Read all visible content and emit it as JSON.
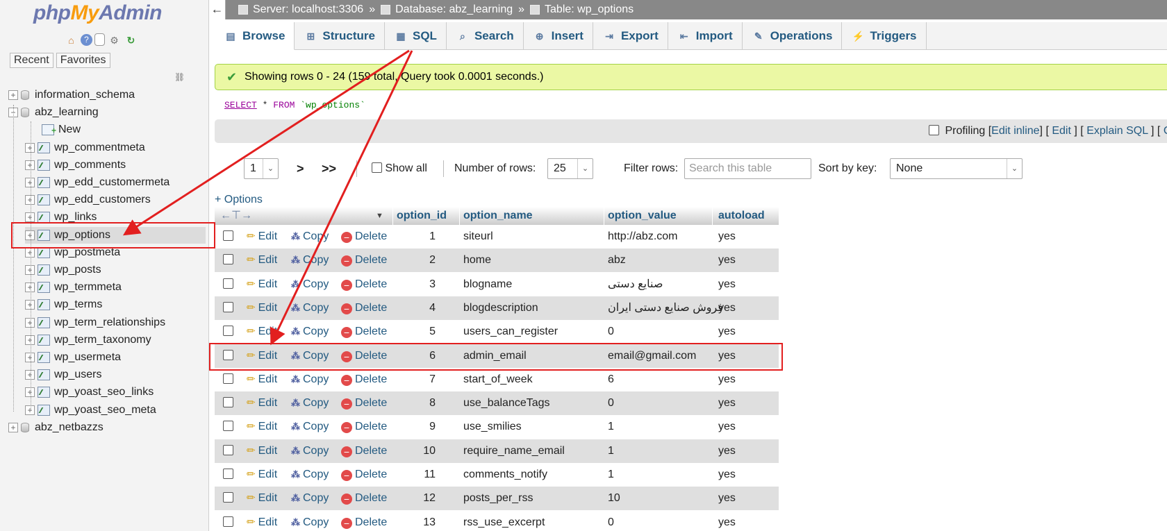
{
  "sidebar": {
    "logo_php": "php",
    "logo_my": "My",
    "logo_admin": "Admin",
    "tabs": [
      "Recent",
      "Favorites"
    ],
    "icons": [
      "home-icon",
      "info-icon",
      "docs-icon",
      "settings-icon",
      "reload-icon"
    ],
    "tree": [
      {
        "label": "information_schema",
        "type": "db",
        "expanded": false
      },
      {
        "label": "abz_learning",
        "type": "db",
        "expanded": true
      },
      {
        "label": "New",
        "type": "new"
      },
      {
        "label": "wp_commentmeta",
        "type": "table"
      },
      {
        "label": "wp_comments",
        "type": "table"
      },
      {
        "label": "wp_edd_customermeta",
        "type": "table"
      },
      {
        "label": "wp_edd_customers",
        "type": "table"
      },
      {
        "label": "wp_links",
        "type": "table"
      },
      {
        "label": "wp_options",
        "type": "table",
        "selected": true
      },
      {
        "label": "wp_postmeta",
        "type": "table"
      },
      {
        "label": "wp_posts",
        "type": "table"
      },
      {
        "label": "wp_termmeta",
        "type": "table"
      },
      {
        "label": "wp_terms",
        "type": "table"
      },
      {
        "label": "wp_term_relationships",
        "type": "table"
      },
      {
        "label": "wp_term_taxonomy",
        "type": "table"
      },
      {
        "label": "wp_usermeta",
        "type": "table"
      },
      {
        "label": "wp_users",
        "type": "table"
      },
      {
        "label": "wp_yoast_seo_links",
        "type": "table"
      },
      {
        "label": "wp_yoast_seo_meta",
        "type": "table"
      },
      {
        "label": "abz_netbazzs",
        "type": "db",
        "expanded": false
      }
    ]
  },
  "breadcrumb": {
    "back": "←",
    "server": "Server: localhost:3306",
    "database": "Database: abz_learning",
    "table": "Table: wp_options",
    "sep": "»"
  },
  "tabs": [
    "Browse",
    "Structure",
    "SQL",
    "Search",
    "Insert",
    "Export",
    "Import",
    "Operations",
    "Triggers"
  ],
  "message": "Showing rows 0 - 24 (159 total, Query took 0.0001 seconds.)",
  "sql": {
    "kw1": "SELECT",
    "mid": " * ",
    "kw2": "FROM",
    "table": "`wp_options`"
  },
  "sql_links": {
    "profiling": "Profiling",
    "edit_inline": "Edit inline",
    "edit": "Edit",
    "explain": "Explain SQL",
    "lb": "[",
    "rb": "]",
    "trail": "C"
  },
  "nav": {
    "page": "1",
    "next": ">",
    "last": ">>",
    "show_all": "Show all",
    "rows_label": "Number of rows:",
    "rows_value": "25",
    "filter_label": "Filter rows:",
    "filter_placeholder": "Search this table",
    "sort_label": "Sort by key:",
    "sort_value": "None"
  },
  "options_link": "+ Options",
  "table": {
    "headers": [
      "option_id",
      "option_name",
      "option_value",
      "autoload"
    ],
    "actions": {
      "edit": "Edit",
      "copy": "Copy",
      "delete": "Delete"
    },
    "rows": [
      {
        "id": "1",
        "name": "siteurl",
        "value": "http://abz.com",
        "autoload": "yes"
      },
      {
        "id": "2",
        "name": "home",
        "value": "abz",
        "autoload": "yes"
      },
      {
        "id": "3",
        "name": "blogname",
        "value": "صنایع دستی",
        "autoload": "yes"
      },
      {
        "id": "4",
        "name": "blogdescription",
        "value": "فروش صنایع دستی ایران",
        "autoload": "yes"
      },
      {
        "id": "5",
        "name": "users_can_register",
        "value": "0",
        "autoload": "yes"
      },
      {
        "id": "6",
        "name": "admin_email",
        "value": "email@gmail.com",
        "autoload": "yes",
        "highlighted": true
      },
      {
        "id": "7",
        "name": "start_of_week",
        "value": "6",
        "autoload": "yes"
      },
      {
        "id": "8",
        "name": "use_balanceTags",
        "value": "0",
        "autoload": "yes"
      },
      {
        "id": "9",
        "name": "use_smilies",
        "value": "1",
        "autoload": "yes"
      },
      {
        "id": "10",
        "name": "require_name_email",
        "value": "1",
        "autoload": "yes"
      },
      {
        "id": "11",
        "name": "comments_notify",
        "value": "1",
        "autoload": "yes"
      },
      {
        "id": "12",
        "name": "posts_per_rss",
        "value": "10",
        "autoload": "yes"
      },
      {
        "id": "13",
        "name": "rss_use_excerpt",
        "value": "0",
        "autoload": "yes"
      }
    ]
  },
  "colors": {
    "link": "#235a81",
    "annotation": "#e21f1f",
    "success_bg": "#ebf8a4"
  }
}
